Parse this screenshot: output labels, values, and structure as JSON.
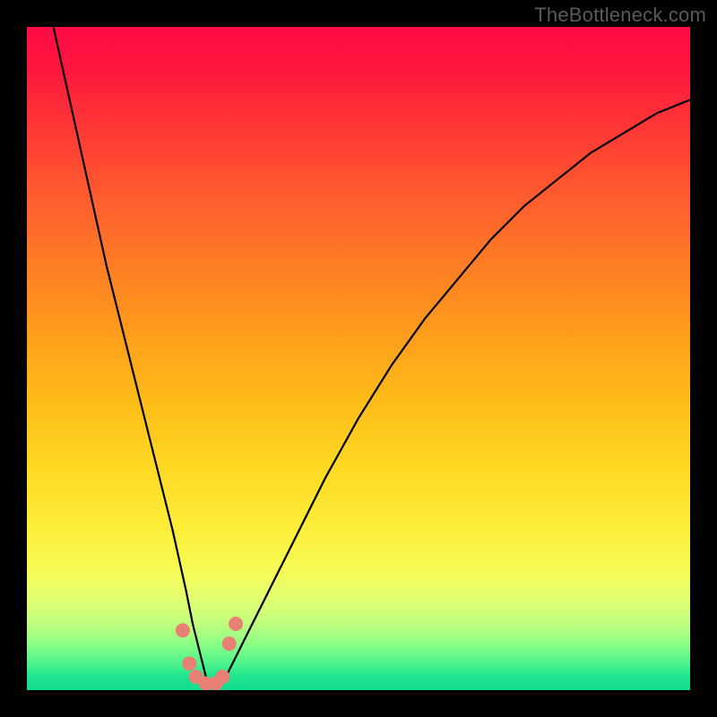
{
  "watermark": "TheBottleneck.com",
  "colors": {
    "frame": "#000000",
    "gradient_top": "#ff0a46",
    "gradient_bottom": "#0edb8c",
    "curve": "#000000",
    "marker": "#e98074"
  },
  "chart_data": {
    "type": "line",
    "title": "",
    "xlabel": "",
    "ylabel": "",
    "xlim": [
      0,
      100
    ],
    "ylim": [
      0,
      100
    ],
    "grid": false,
    "legend": false,
    "comment": "V-shaped bottleneck curve. y≈0 is best (green). Minimum around x≈27. No numeric axis ticks visible.",
    "series": [
      {
        "name": "bottleneck-curve",
        "x": [
          4,
          6,
          8,
          10,
          12,
          14,
          16,
          18,
          20,
          22,
          24,
          25,
          26,
          27,
          28,
          29,
          30,
          31,
          33,
          36,
          40,
          45,
          50,
          55,
          60,
          65,
          70,
          75,
          80,
          85,
          90,
          95,
          100
        ],
        "y": [
          100,
          91,
          82,
          73,
          64,
          56,
          48,
          40,
          32,
          24,
          15,
          10,
          6,
          2,
          1,
          1,
          2,
          4,
          8,
          14,
          22,
          32,
          41,
          49,
          56,
          62,
          68,
          73,
          77,
          81,
          84,
          87,
          89
        ]
      }
    ],
    "markers": {
      "name": "estimated-data-points",
      "comment": "Salmon dots near curve minimum; approximate positions read from pixels.",
      "x": [
        23.5,
        24.5,
        25.5,
        27,
        28.5,
        29.5,
        30.5,
        31.5
      ],
      "y": [
        9,
        4,
        2,
        1,
        1,
        2,
        7,
        10
      ]
    }
  }
}
